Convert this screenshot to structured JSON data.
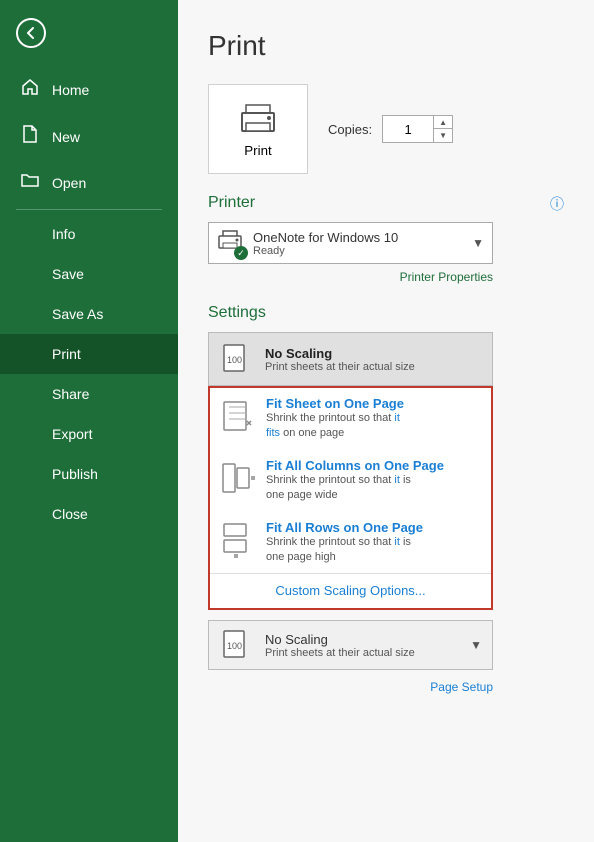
{
  "sidebar": {
    "back_label": "",
    "items": [
      {
        "id": "home",
        "label": "Home",
        "icon": "🏠"
      },
      {
        "id": "new",
        "label": "New",
        "icon": "📄"
      },
      {
        "id": "open",
        "label": "Open",
        "icon": "📂"
      },
      {
        "id": "info",
        "label": "Info",
        "icon": ""
      },
      {
        "id": "save",
        "label": "Save",
        "icon": ""
      },
      {
        "id": "save-as",
        "label": "Save As",
        "icon": ""
      },
      {
        "id": "print",
        "label": "Print",
        "icon": ""
      },
      {
        "id": "share",
        "label": "Share",
        "icon": ""
      },
      {
        "id": "export",
        "label": "Export",
        "icon": ""
      },
      {
        "id": "publish",
        "label": "Publish",
        "icon": ""
      },
      {
        "id": "close",
        "label": "Close",
        "icon": ""
      }
    ]
  },
  "main": {
    "title": "Print",
    "copies_label": "Copies:",
    "copies_value": "1",
    "print_button_label": "Print",
    "printer_section_label": "Printer",
    "printer_name": "OneNote for Windows 10",
    "printer_status": "Ready",
    "printer_properties_link": "Printer Properties",
    "settings_section_label": "Settings",
    "selected_scaling_title": "No Scaling",
    "selected_scaling_desc": "Print sheets at their actual size",
    "options": [
      {
        "id": "fit-sheet",
        "title": "Fit Sheet on One Page",
        "desc_part1": "Shrink the printout so that it",
        "desc_part2": "fits on one page",
        "desc_blue": "fits"
      },
      {
        "id": "fit-columns",
        "title": "Fit All Columns on One Page",
        "desc_part1": "Shrink the printout so that it is",
        "desc_part2": "one page wide",
        "desc_blue": "it"
      },
      {
        "id": "fit-rows",
        "title": "Fit All Rows on One Page",
        "desc_part1": "Shrink the printout so that it is",
        "desc_part2": "one page high",
        "desc_blue": "it"
      }
    ],
    "custom_scaling_label": "Custom Scaling Options...",
    "bottom_scaling_title": "No Scaling",
    "bottom_scaling_desc": "Print sheets at their actual size",
    "page_setup_link": "Page Setup"
  }
}
